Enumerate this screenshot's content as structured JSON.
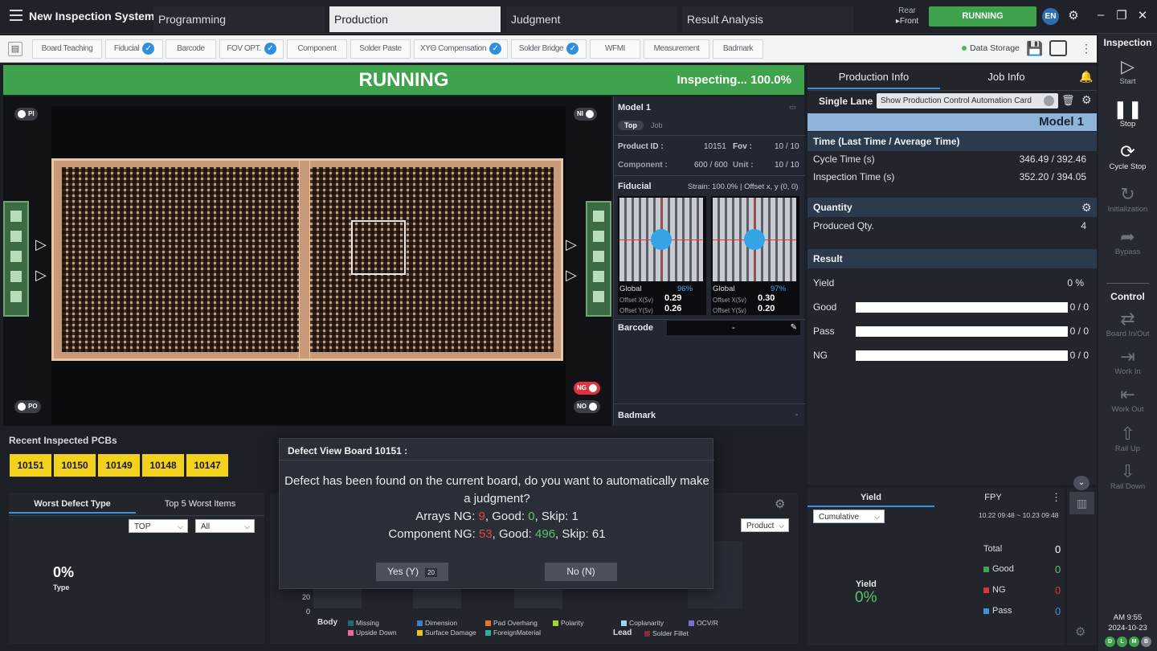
{
  "app": {
    "title": "New Inspection System"
  },
  "tabs": [
    {
      "label": "Programming"
    },
    {
      "label": "Production"
    },
    {
      "label": "Judgment"
    },
    {
      "label": "Result Analysis"
    }
  ],
  "header": {
    "rear": "Rear",
    "front": "▸Front",
    "status_button": "RUNNING",
    "language": "EN"
  },
  "toolbar": {
    "items": [
      "Board Teaching",
      "Fiducial",
      "Barcode",
      "FOV OPT.",
      "Component",
      "Solder Paste",
      "XYΘ Compensation",
      "Solder Bridge",
      "WFMI",
      "Measurement",
      "Badmark"
    ],
    "data_storage": "Data Storage"
  },
  "running_bar": {
    "title": "RUNNING",
    "status": "Inspecting... 100.0%"
  },
  "board_view": {
    "pi": "PI",
    "po": "PO",
    "ni": "NI",
    "ng": "NG",
    "no": "NO"
  },
  "model_panel": {
    "model": "Model 1",
    "top": "Top",
    "job": "Job",
    "product_id_label": "Product ID :",
    "product_id": "10151",
    "fov_label": "Fov :",
    "fov": "10 / 10",
    "component_label": "Component :",
    "component": "600 / 600",
    "unit_label": "Unit :",
    "unit": "10 / 10",
    "fiducial_label": "Fiducial",
    "strain": "Strain: 100.0% | Offset x, y (0, 0)",
    "fid1": {
      "global": "Global",
      "pct": "96%",
      "ox_label": "Offset X(㏜)",
      "ox": "0.29",
      "oy_label": "Offset Y(㏜)",
      "oy": "0.26"
    },
    "fid2": {
      "global": "Global",
      "pct": "97%",
      "ox_label": "Offset X(㏜)",
      "ox": "0.30",
      "oy_label": "Offset Y(㏜)",
      "oy": "0.20"
    },
    "barcode_label": "Barcode",
    "barcode_value": "-",
    "badmark_label": "Badmark",
    "badmark_value": "-"
  },
  "production_info": {
    "tab_production": "Production Info",
    "tab_job": "Job Info",
    "lane": "Single Lane",
    "automation_card": "Show Production Control Automation Card",
    "model": "Model 1",
    "time_header": "Time (Last Time / Average Time)",
    "cycle_label": "Cycle Time (s)",
    "cycle_value": "346.49 / 392.46",
    "insp_label": "Inspection Time (s)",
    "insp_value": "352.20 / 394.05",
    "qty_header": "Quantity",
    "produced_label": "Produced Qty.",
    "produced_value": "4",
    "result_header": "Result",
    "yield_label": "Yield",
    "yield_value": "0 %",
    "good_label": "Good",
    "good_value": "0 / 0",
    "pass_label": "Pass",
    "pass_value": "0 / 0",
    "ng_label": "NG",
    "ng_value": "0 / 0"
  },
  "recent": {
    "title": "Recent Inspected PCBs",
    "pcbs": [
      "10151",
      "10150",
      "10149",
      "10148",
      "10147"
    ]
  },
  "worst_defect": {
    "tab1": "Worst Defect Type",
    "tab2": "Top 5 Worst Items",
    "select1": "TOP",
    "select2": "All",
    "pct": "0%",
    "type_label": "Type"
  },
  "defect_chart": {
    "select": "Product",
    "y20": "20",
    "y0": "0",
    "body": "Body",
    "lead": "Lead",
    "legend": [
      {
        "label": "Missing",
        "color": "#1f6b6b"
      },
      {
        "label": "Upside Down",
        "color": "#e86aa0"
      },
      {
        "label": "Dimension",
        "color": "#3a82c8"
      },
      {
        "label": "Surface Damage",
        "color": "#e8c21f"
      },
      {
        "label": "Pad Overhang",
        "color": "#e8742a"
      },
      {
        "label": "ForeignMaterial",
        "color": "#2fae9a"
      },
      {
        "label": "Polarity",
        "color": "#a6d12f"
      },
      {
        "label": "Coplanarity",
        "color": "#9ed4ea"
      },
      {
        "label": "Solder Fillet",
        "color": "#8a2a3a"
      },
      {
        "label": "OCV/R",
        "color": "#7a6fd6"
      }
    ]
  },
  "dialog": {
    "title": "Defect View Board 10151 :",
    "line1": "Defect has been found on the current board, do you want to automatically make",
    "line2": "a judgment?",
    "arrays_prefix": "Arrays NG: ",
    "arrays_ng": "9",
    "arrays_good_prefix": ", Good: ",
    "arrays_good": "0",
    "arrays_skip": ", Skip: 1",
    "comp_prefix": "Component NG: ",
    "comp_ng": "53",
    "comp_good_prefix": ", Good: ",
    "comp_good": "496",
    "comp_skip": ", Skip: 61",
    "yes": "Yes (Y)",
    "yes_count": "20",
    "no": "No (N)"
  },
  "yield_panel": {
    "tab_yield": "Yield",
    "tab_fpy": "FPY",
    "select": "Cumulative",
    "range": "10.22 09:48 ~ 10.23 09:48",
    "yield_label": "Yield",
    "yield_value": "0%",
    "total_label": "Total",
    "total_value": "0",
    "good_label": "Good",
    "good_value": "0",
    "ng_label": "NG",
    "ng_value": "0",
    "pass_label": "Pass",
    "pass_value": "0"
  },
  "sidebar": {
    "inspection_header": "Inspection",
    "start": "Start",
    "stop": "Stop",
    "cycle_stop": "Cycle Stop",
    "initialization": "Initialization",
    "bypass": "Bypass",
    "control_header": "Control",
    "board_inout": "Board In/Out",
    "work_in": "Work In",
    "work_out": "Work Out",
    "rail_up": "Rail Up",
    "rail_down": "Rail Down",
    "time": "AM 9:55",
    "date": "2024-10-23",
    "status_letters": [
      "D",
      "L",
      "M",
      "B"
    ]
  }
}
